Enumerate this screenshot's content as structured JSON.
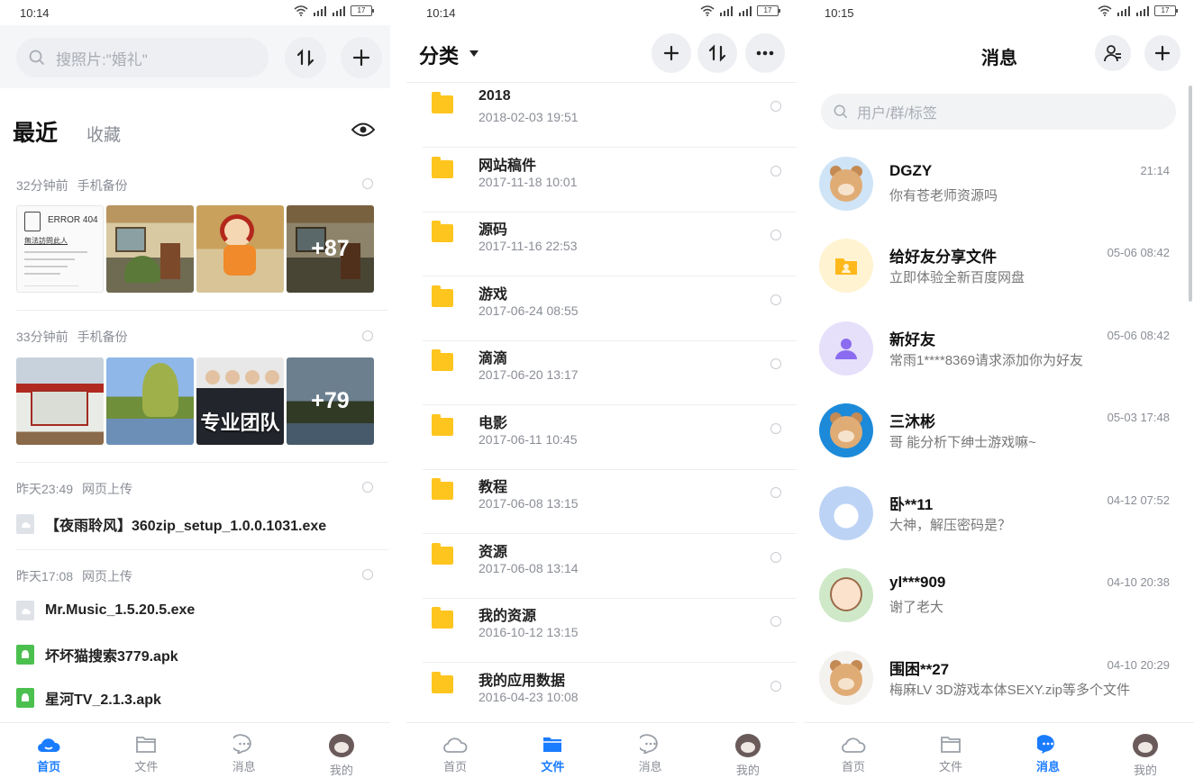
{
  "panel_home": {
    "status_time": "10:14",
    "battery": "17",
    "search_placeholder": "搜照片:\"婚礼\"",
    "tab_recent": "最近",
    "tab_favorites": "收藏",
    "groups": [
      {
        "time": "32分钟前",
        "source": "手机备份",
        "more": "+87",
        "error_title": "ERROR 404",
        "error_sub": "無法訪問此人"
      },
      {
        "time": "33分钟前",
        "source": "手机备份",
        "more": "+79",
        "caption": "专业团队"
      },
      {
        "time": "昨天23:49",
        "source": "网页上传",
        "files": [
          "【夜雨聆风】360zip_setup_1.0.0.1031.exe"
        ]
      },
      {
        "time": "昨天17:08",
        "source": "网页上传",
        "files": [
          "Mr.Music_1.5.20.5.exe",
          "坏坏猫搜索3779.apk",
          "星河TV_2.1.3.apk"
        ]
      }
    ]
  },
  "panel_files": {
    "status_time": "10:14",
    "battery": "17",
    "title": "分类",
    "folders": [
      {
        "name": "2018",
        "date": "2018-02-03  19:51"
      },
      {
        "name": "网站稿件",
        "date": "2017-11-18  10:01"
      },
      {
        "name": "源码",
        "date": "2017-11-16  22:53"
      },
      {
        "name": "游戏",
        "date": "2017-06-24  08:55"
      },
      {
        "name": "滴滴",
        "date": "2017-06-20  13:17"
      },
      {
        "name": "电影",
        "date": "2017-06-11  10:45"
      },
      {
        "name": "教程",
        "date": "2017-06-08  13:15"
      },
      {
        "name": "资源",
        "date": "2017-06-08  13:14"
      },
      {
        "name": "我的资源",
        "date": "2016-10-12  13:15"
      },
      {
        "name": "我的应用数据",
        "date": "2016-04-23  10:08"
      }
    ]
  },
  "panel_messages": {
    "status_time": "10:15",
    "battery": "17",
    "title": "消息",
    "search_placeholder": "用户/群/标签",
    "messages": [
      {
        "name": "DGZY",
        "time": "21:14",
        "text": "你有苍老师资源吗"
      },
      {
        "name": "给好友分享文件",
        "time": "05-06 08:42",
        "text": "立即体验全新百度网盘"
      },
      {
        "name": "新好友",
        "time": "05-06 08:42",
        "text": "常雨1****8369请求添加你为好友"
      },
      {
        "name": "三沐彬",
        "time": "05-03 17:48",
        "text": "哥 能分析下绅士游戏嘛~"
      },
      {
        "name": "卧**11",
        "time": "04-12 07:52",
        "text": " 大神，解压密码是？"
      },
      {
        "name": "yl***909",
        "time": "04-10 20:38",
        "text": "谢了老大"
      },
      {
        "name": "围困**27",
        "time": "04-10 20:29",
        "text": "梅麻LV 3D游戏本体SEXY.zip等多个文件"
      }
    ]
  },
  "nav": {
    "home": "首页",
    "files": "文件",
    "messages": "消息",
    "mine": "我的"
  },
  "colors": {
    "accent": "#1a7cff",
    "folder": "#ffc51f",
    "apk": "#4cc04f"
  }
}
